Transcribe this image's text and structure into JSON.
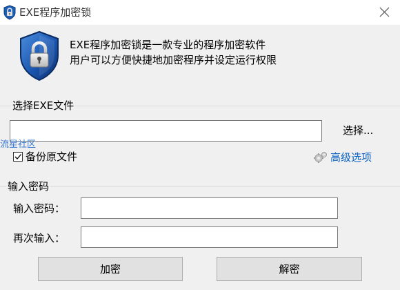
{
  "window": {
    "title": "EXE程序加密锁"
  },
  "header": {
    "description_line1": "EXE程序加密锁是一款专业的程序加密软件",
    "description_line2": "用户可以方便快捷地加密程序并设定运行权限"
  },
  "file_group": {
    "title": "选择EXE文件",
    "file_path_value": "",
    "browse_label": "选择...",
    "backup_checked": true,
    "backup_label": "备份原文件",
    "advanced_label": "高级选项"
  },
  "watermark": "流星社区",
  "password_group": {
    "title": "输入密码",
    "password_label": "输入密码：",
    "password_value": "",
    "confirm_label": "再次输入：",
    "confirm_value": ""
  },
  "buttons": {
    "encrypt": "加密",
    "decrypt": "解密"
  },
  "icons": {
    "title": "lock-shield-icon",
    "header": "lock-shield-icon",
    "close": "close-icon",
    "advanced": "gear-icon",
    "checkbox": "check-icon"
  },
  "colors": {
    "window_bg": "#f0f0f0",
    "titlebar_bg": "#ffffff",
    "link_blue": "#0b62c4",
    "watermark_blue": "#3a7ad0",
    "button_bg": "#e1e1e1"
  }
}
